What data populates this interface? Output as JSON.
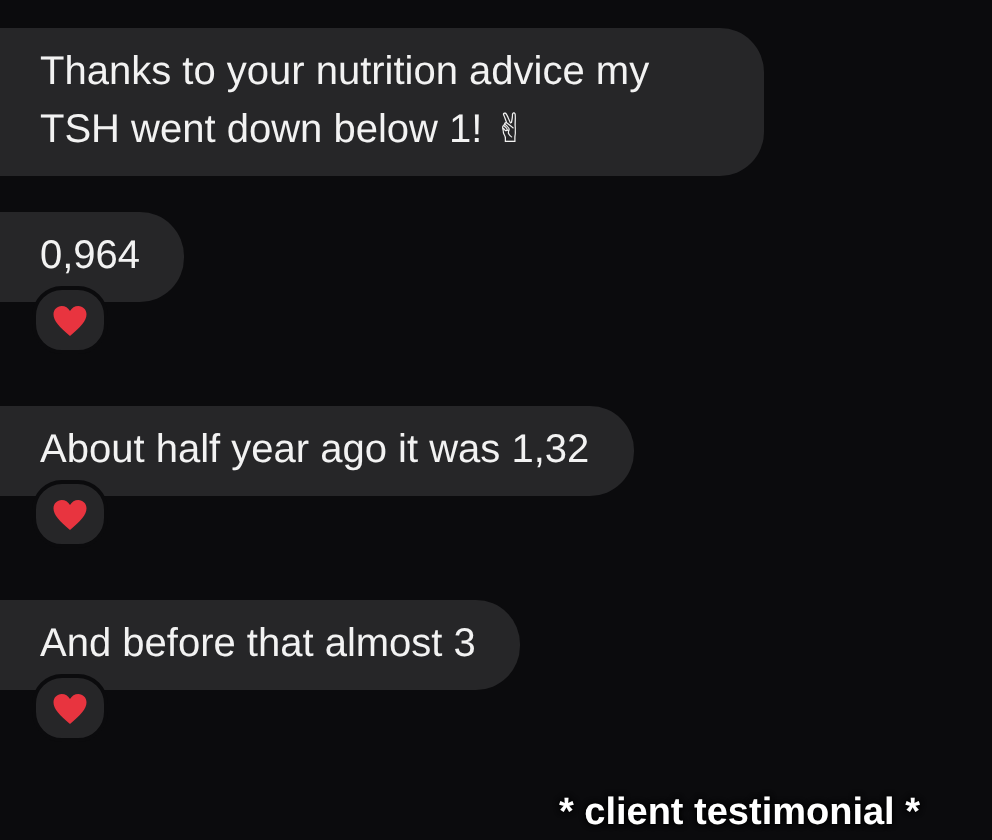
{
  "messages": [
    {
      "text": "Thanks to your nutrition advice my TSH went down below 1! ✌",
      "reacted": false
    },
    {
      "text": "0,964",
      "reacted": true
    },
    {
      "text": "About half year ago it was 1,32",
      "reacted": true
    },
    {
      "text": "And before that almost 3",
      "reacted": true
    }
  ],
  "caption": "* client testimonial *"
}
